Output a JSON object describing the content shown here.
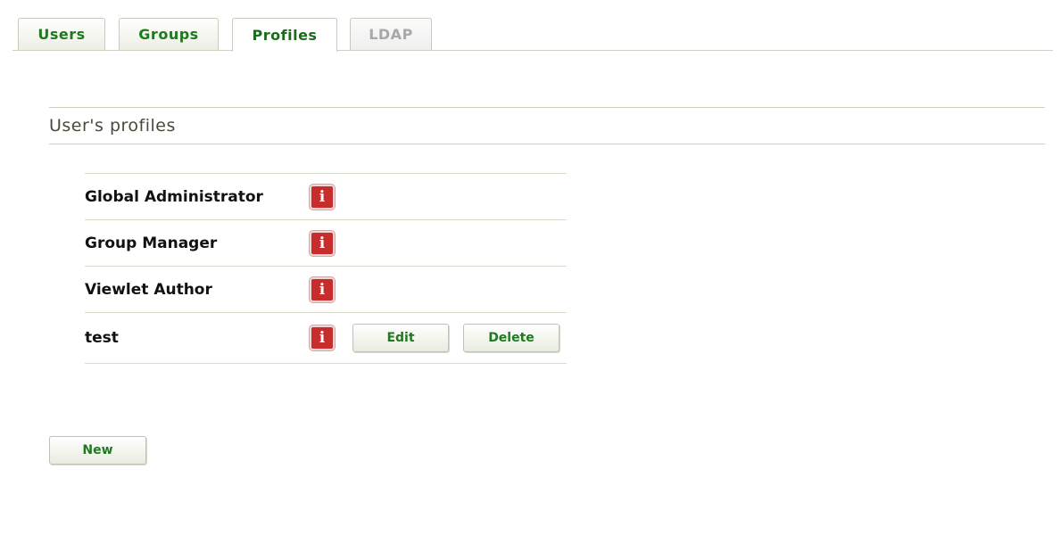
{
  "tabs": [
    {
      "label": "Users",
      "state": "normal"
    },
    {
      "label": "Groups",
      "state": "normal"
    },
    {
      "label": "Profiles",
      "state": "active"
    },
    {
      "label": "LDAP",
      "state": "disabled"
    }
  ],
  "section": {
    "title": "User's profiles"
  },
  "profiles": [
    {
      "name": "Global Administrator",
      "info_icon": "i"
    },
    {
      "name": "Group Manager",
      "info_icon": "i"
    },
    {
      "name": "Viewlet Author",
      "info_icon": "i"
    },
    {
      "name": "test",
      "info_icon": "i",
      "edit_label": "Edit",
      "delete_label": "Delete"
    }
  ],
  "actions": {
    "new_label": "New"
  },
  "colors": {
    "accent_green": "#1e7a1e",
    "info_red": "#c62d2d",
    "rule": "#c9d2bb"
  },
  "icons": {
    "info": "info-icon"
  }
}
